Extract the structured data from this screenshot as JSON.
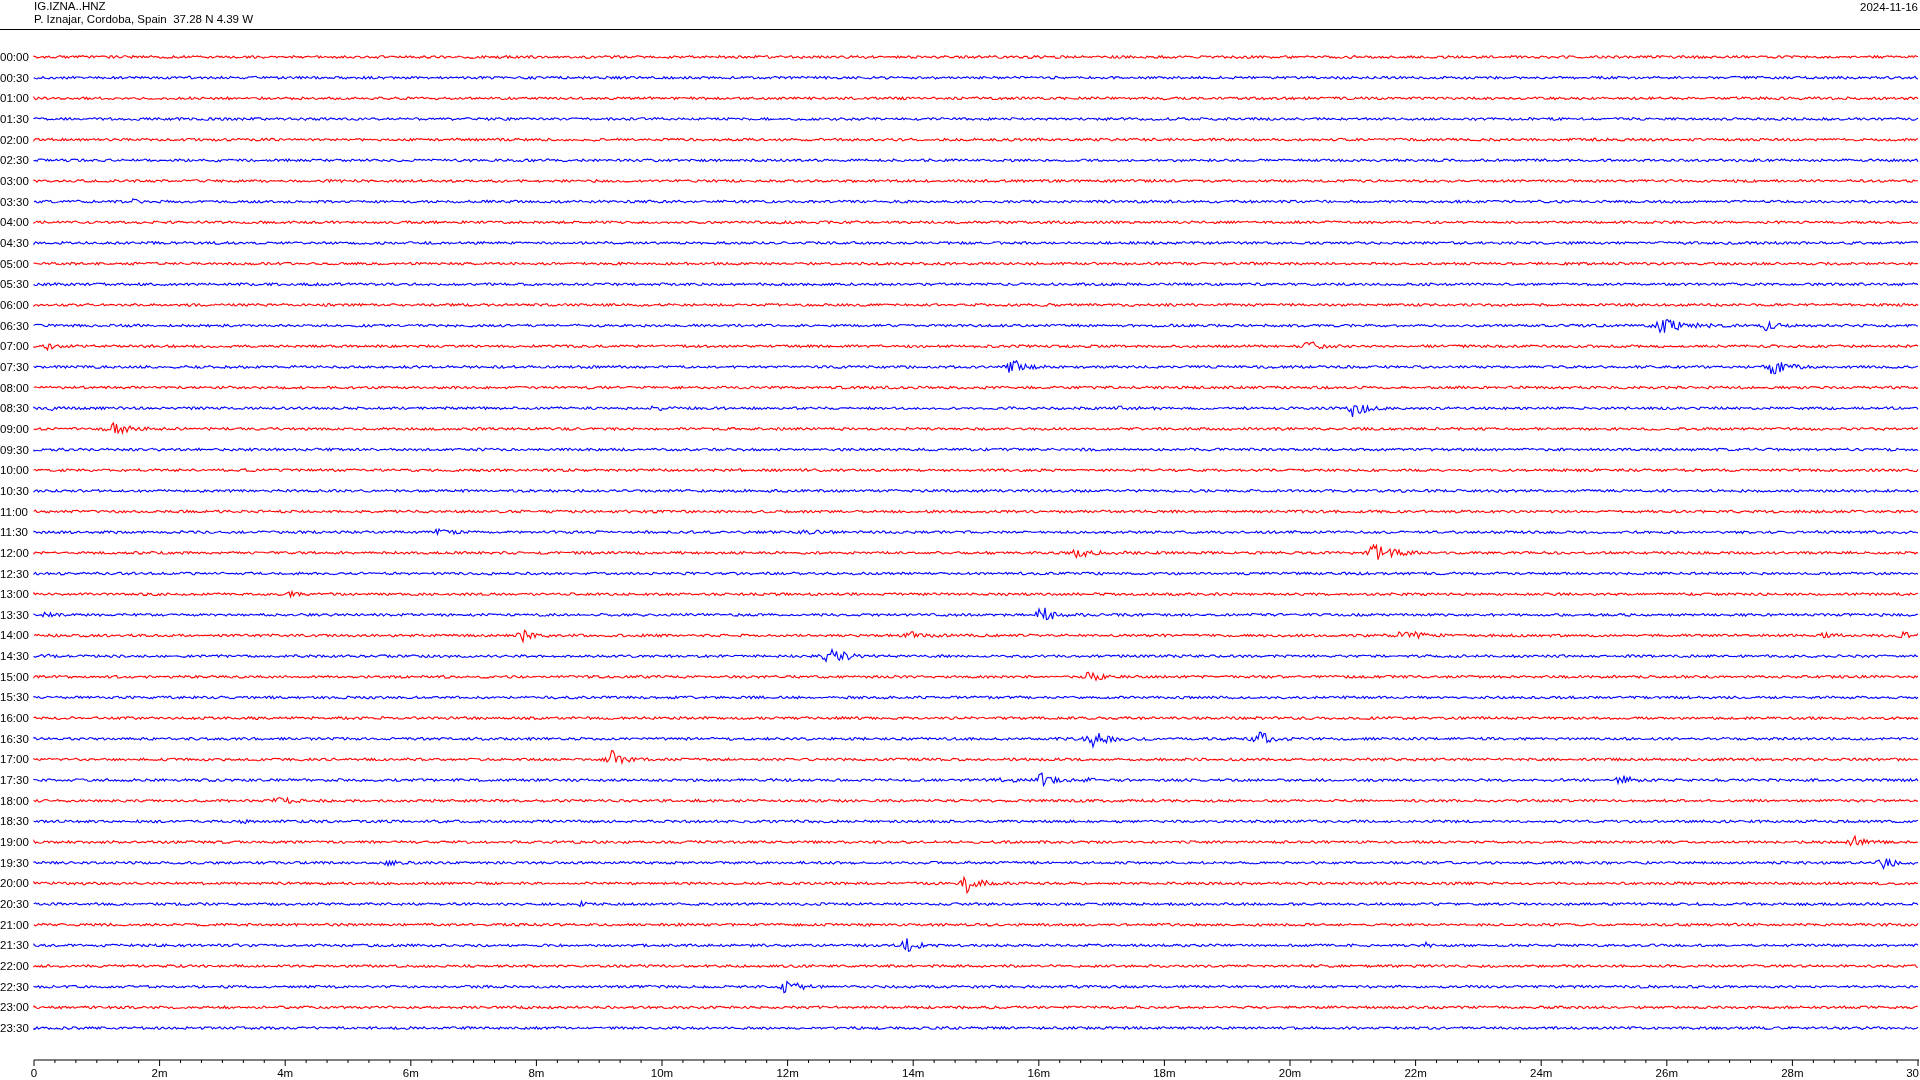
{
  "header": {
    "station": "IG.IZNA..HNZ",
    "location": "P. Iznajar, Cordoba, Spain  37.28 N 4.39 W",
    "date": "2024-11-16"
  },
  "traces": [
    {
      "label": "00:00",
      "color": "#ff0000"
    },
    {
      "label": "00:30",
      "color": "#0000ff"
    },
    {
      "label": "01:00",
      "color": "#ff0000"
    },
    {
      "label": "01:30",
      "color": "#0000ff"
    },
    {
      "label": "02:00",
      "color": "#ff0000"
    },
    {
      "label": "02:30",
      "color": "#0000ff"
    },
    {
      "label": "03:00",
      "color": "#ff0000"
    },
    {
      "label": "03:30",
      "color": "#0000ff"
    },
    {
      "label": "04:00",
      "color": "#ff0000"
    },
    {
      "label": "04:30",
      "color": "#0000ff"
    },
    {
      "label": "05:00",
      "color": "#ff0000"
    },
    {
      "label": "05:30",
      "color": "#0000ff"
    },
    {
      "label": "06:00",
      "color": "#ff0000"
    },
    {
      "label": "06:30",
      "color": "#0000ff"
    },
    {
      "label": "07:00",
      "color": "#ff0000"
    },
    {
      "label": "07:30",
      "color": "#0000ff"
    },
    {
      "label": "08:00",
      "color": "#ff0000"
    },
    {
      "label": "08:30",
      "color": "#0000ff"
    },
    {
      "label": "09:00",
      "color": "#ff0000"
    },
    {
      "label": "09:30",
      "color": "#0000ff"
    },
    {
      "label": "10:00",
      "color": "#ff0000"
    },
    {
      "label": "10:30",
      "color": "#0000ff"
    },
    {
      "label": "11:00",
      "color": "#ff0000"
    },
    {
      "label": "11:30",
      "color": "#0000ff"
    },
    {
      "label": "12:00",
      "color": "#ff0000"
    },
    {
      "label": "12:30",
      "color": "#0000ff"
    },
    {
      "label": "13:00",
      "color": "#ff0000"
    },
    {
      "label": "13:30",
      "color": "#0000ff"
    },
    {
      "label": "14:00",
      "color": "#ff0000"
    },
    {
      "label": "14:30",
      "color": "#0000ff"
    },
    {
      "label": "15:00",
      "color": "#ff0000"
    },
    {
      "label": "15:30",
      "color": "#0000ff"
    },
    {
      "label": "16:00",
      "color": "#ff0000"
    },
    {
      "label": "16:30",
      "color": "#0000ff"
    },
    {
      "label": "17:00",
      "color": "#ff0000"
    },
    {
      "label": "17:30",
      "color": "#0000ff"
    },
    {
      "label": "18:00",
      "color": "#ff0000"
    },
    {
      "label": "18:30",
      "color": "#0000ff"
    },
    {
      "label": "19:00",
      "color": "#ff0000"
    },
    {
      "label": "19:30",
      "color": "#0000ff"
    },
    {
      "label": "20:00",
      "color": "#ff0000"
    },
    {
      "label": "20:30",
      "color": "#0000ff"
    },
    {
      "label": "21:00",
      "color": "#ff0000"
    },
    {
      "label": "21:30",
      "color": "#0000ff"
    },
    {
      "label": "22:00",
      "color": "#ff0000"
    },
    {
      "label": "22:30",
      "color": "#0000ff"
    },
    {
      "label": "23:00",
      "color": "#ff0000"
    },
    {
      "label": "23:30",
      "color": "#0000ff"
    }
  ],
  "x_axis": {
    "labels": [
      "0",
      "2m",
      "4m",
      "6m",
      "8m",
      "10m",
      "12m",
      "14m",
      "16m",
      "18m",
      "20m",
      "22m",
      "24m",
      "26m",
      "28m",
      "30"
    ]
  }
}
